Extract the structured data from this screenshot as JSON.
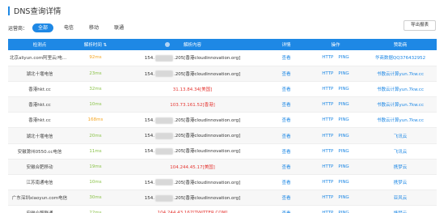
{
  "title": "DNS查询详情",
  "filter": {
    "label": "运营商：",
    "options": [
      "全部",
      "电信",
      "移动",
      "联通"
    ],
    "active": "全部"
  },
  "export_label": "导出报表",
  "table": {
    "headers": [
      "检测点",
      "解析时间 ⇅",
      "解析内容",
      "详情",
      "操作",
      "赞助商"
    ],
    "rows": [
      {
        "node": "北京aliyun.com阿里云/电信/...",
        "time": "92ms",
        "ip_prefix": "154.",
        "ip_suffix": ".205[香港cloudinnovation.org]",
        "masked": true,
        "red": false,
        "detail": "查看",
        "op1": "HTTP",
        "op2": "PING",
        "sponsor": "华商数据QQ376432952"
      },
      {
        "node": "湖北十堰电信",
        "time": "23ms",
        "ip_prefix": "154.",
        "ip_suffix": ".205[香港cloudinnovation.org]",
        "masked": true,
        "red": false,
        "detail": "查看",
        "op1": "HTTP",
        "op2": "PING",
        "sponsor": "书敷云计算yun.7kw.cc"
      },
      {
        "node": "香港hkt.cc",
        "time": "32ms",
        "ip_prefix": "",
        "ip_suffix": "31.13.84.34[美国]",
        "masked": false,
        "red": true,
        "detail": "查看",
        "op1": "HTTP",
        "op2": "PING",
        "sponsor": "书敷云计算yun.7kw.cc"
      },
      {
        "node": "香港hkt.cc",
        "time": "10ms",
        "ip_prefix": "",
        "ip_suffix": "103.73.161.52[香港]",
        "masked": false,
        "red": true,
        "detail": "查看",
        "op1": "HTTP",
        "op2": "PING",
        "sponsor": "书敷云计算yun.7kw.cc"
      },
      {
        "node": "香港hkt.cc",
        "time": "168ms",
        "ip_prefix": "154.",
        "ip_suffix": ".205[香港cloudinnovation.org]",
        "masked": true,
        "red": false,
        "detail": "查看",
        "op1": "HTTP",
        "op2": "PING",
        "sponsor": "书敷云计算yun.7kw.cc"
      },
      {
        "node": "湖北十堰电信",
        "time": "20ms",
        "ip_prefix": "154.",
        "ip_suffix": ".205[香港cloudinnovation.org]",
        "masked": true,
        "red": false,
        "detail": "查看",
        "op1": "HTTP",
        "op2": "PING",
        "sponsor": "飞讯云"
      },
      {
        "node": "安徽滁州0550.cc电信",
        "time": "11ms",
        "ip_prefix": "154.",
        "ip_suffix": ".205[香港cloudinnovation.org]",
        "masked": true,
        "red": false,
        "detail": "查看",
        "op1": "HTTP",
        "op2": "PING",
        "sponsor": "飞讯云"
      },
      {
        "node": "安徽合肥移动",
        "time": "19ms",
        "ip_prefix": "",
        "ip_suffix": "104.244.45.17[美国]",
        "masked": false,
        "red": true,
        "detail": "查看",
        "op1": "HTTP",
        "op2": "PING",
        "sponsor": "携梦云"
      },
      {
        "node": "江苏南通电信",
        "time": "10ms",
        "ip_prefix": "154.",
        "ip_suffix": ".205[香港cloudinnovation.org]",
        "masked": true,
        "red": false,
        "detail": "查看",
        "op1": "HTTP",
        "op2": "PING",
        "sponsor": "携梦云"
      },
      {
        "node": "广东深圳xiaoyun.com电信",
        "time": "30ms",
        "ip_prefix": "154.",
        "ip_suffix": ".205[香港cloudinnovation.org]",
        "masked": true,
        "red": false,
        "detail": "查看",
        "op1": "HTTP",
        "op2": "PING",
        "sponsor": "亚风云"
      },
      {
        "node": "安徽合肥联通",
        "time": "22ms",
        "ip_prefix": "",
        "ip_suffix": "104.244.43.167[TWITTER.COM]",
        "masked": false,
        "red": true,
        "detail": "查看",
        "op1": "HTTP",
        "op2": "PING",
        "sponsor": "携梦云"
      }
    ]
  },
  "colors": {
    "accent": "#1e88e5",
    "fast": "#8bc34a",
    "slow": "#f5a623",
    "error": "#e53935"
  }
}
